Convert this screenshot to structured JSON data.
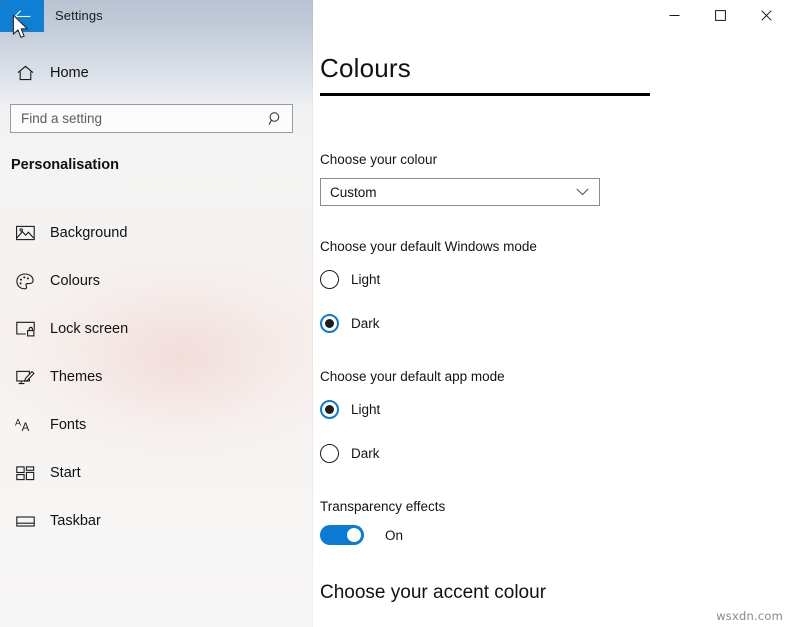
{
  "window": {
    "title": "Settings",
    "back_icon": "back-arrow-icon",
    "controls": {
      "minimize_label": "—",
      "maximize_label": "□",
      "close_label": "✕"
    }
  },
  "sidebar": {
    "home": {
      "label": "Home",
      "icon": "home-icon"
    },
    "search": {
      "value": "",
      "placeholder": "Find a setting",
      "icon": "search-icon"
    },
    "section_header": "Personalisation",
    "items": [
      {
        "label": "Background",
        "icon": "picture-icon"
      },
      {
        "label": "Colours",
        "icon": "palette-icon"
      },
      {
        "label": "Lock screen",
        "icon": "lock-screen-icon"
      },
      {
        "label": "Themes",
        "icon": "themes-brush-icon"
      },
      {
        "label": "Fonts",
        "icon": "fonts-aa-icon"
      },
      {
        "label": "Start",
        "icon": "start-tiles-icon"
      },
      {
        "label": "Taskbar",
        "icon": "taskbar-icon"
      }
    ]
  },
  "main": {
    "page_title": "Colours",
    "choose_colour": {
      "label": "Choose your colour",
      "selected": "Custom",
      "chevron_icon": "chevron-down-icon"
    },
    "windows_mode": {
      "label": "Choose your default Windows mode",
      "options": [
        {
          "label": "Light",
          "checked": false
        },
        {
          "label": "Dark",
          "checked": true
        }
      ]
    },
    "app_mode": {
      "label": "Choose your default app mode",
      "options": [
        {
          "label": "Light",
          "checked": true
        },
        {
          "label": "Dark",
          "checked": false
        }
      ]
    },
    "transparency": {
      "label": "Transparency effects",
      "state_label": "On",
      "checked": true
    },
    "accent_heading": "Choose your accent colour"
  },
  "watermark": "wsxdn.com",
  "colors": {
    "accent_blue": "#0a7bd4",
    "back_button_blue": "#0f7fd4",
    "rule_black": "#000000"
  }
}
